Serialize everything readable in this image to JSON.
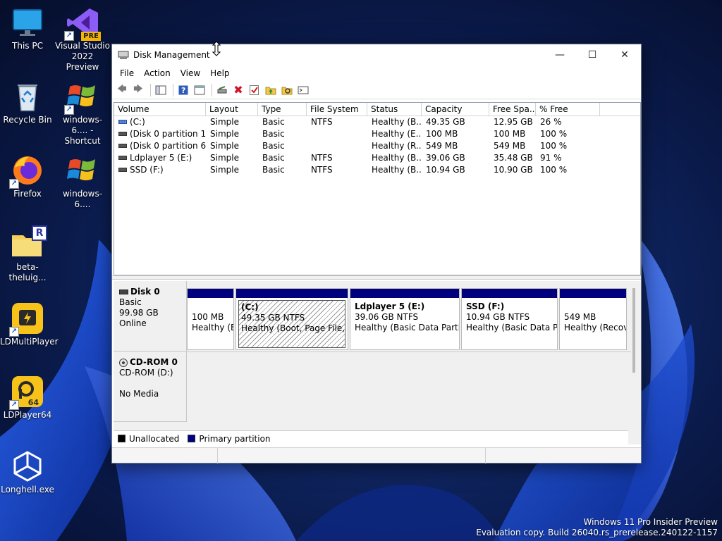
{
  "desktop": {
    "icons": [
      {
        "label": "This PC",
        "icon": "monitor-icon"
      },
      {
        "label": "Visual Studio 2022 Preview",
        "icon": "visual-studio-icon",
        "badge": "PRE"
      },
      {
        "label": "Recycle Bin",
        "icon": "recycle-bin-icon"
      },
      {
        "label": "windows-6.... - Shortcut",
        "icon": "windows-logo-icon"
      },
      {
        "label": "Firefox",
        "icon": "firefox-icon"
      },
      {
        "label": "windows-6....",
        "icon": "windows-logo-icon"
      },
      {
        "label": "beta-theluig...",
        "icon": "rar-archive-icon",
        "badge": "R"
      },
      {
        "label": "LDMultiPlayer",
        "icon": "ldmultiplayer-icon"
      },
      {
        "label": "LDPlayer64",
        "icon": "ldplayer64-icon",
        "badge": "64"
      },
      {
        "label": "Longhell.exe",
        "icon": "unity-icon"
      }
    ],
    "watermark": {
      "line1": "Windows 11 Pro Insider Preview",
      "line2": "Evaluation copy. Build 26040.rs_prerelease.240122-1157"
    }
  },
  "window": {
    "title": "Disk Management",
    "controls": {
      "minimize": "—",
      "maximize": "☐",
      "close": "✕"
    },
    "menu": [
      "File",
      "Action",
      "View",
      "Help"
    ],
    "toolbar": [
      "back-arrow-icon",
      "forward-arrow-icon",
      "console-tree-icon",
      "help-icon",
      "properties-icon",
      "connect-disk-icon",
      "delete-icon",
      "checkmark-icon",
      "folder-up-icon",
      "search-folder-icon",
      "rescan-icon"
    ],
    "volume_list": {
      "columns": [
        "Volume",
        "Layout",
        "Type",
        "File System",
        "Status",
        "Capacity",
        "Free Spa...",
        "% Free"
      ],
      "rows": [
        {
          "volume": "(C:)",
          "layout": "Simple",
          "type": "Basic",
          "fs": "NTFS",
          "status": "Healthy (B...",
          "capacity": "49.35 GB",
          "free": "12.95 GB",
          "pct": "26 %",
          "glyph": "c"
        },
        {
          "volume": "(Disk 0 partition 1)",
          "layout": "Simple",
          "type": "Basic",
          "fs": "",
          "status": "Healthy (E...",
          "capacity": "100 MB",
          "free": "100 MB",
          "pct": "100 %",
          "glyph": "d"
        },
        {
          "volume": "(Disk 0 partition 6)",
          "layout": "Simple",
          "type": "Basic",
          "fs": "",
          "status": "Healthy (R...",
          "capacity": "549 MB",
          "free": "549 MB",
          "pct": "100 %",
          "glyph": "d"
        },
        {
          "volume": "Ldplayer 5 (E:)",
          "layout": "Simple",
          "type": "Basic",
          "fs": "NTFS",
          "status": "Healthy (B...",
          "capacity": "39.06 GB",
          "free": "35.48 GB",
          "pct": "91 %",
          "glyph": "d"
        },
        {
          "volume": "SSD (F:)",
          "layout": "Simple",
          "type": "Basic",
          "fs": "NTFS",
          "status": "Healthy (B...",
          "capacity": "10.94 GB",
          "free": "10.90 GB",
          "pct": "100 %",
          "glyph": "d"
        }
      ]
    },
    "disks": [
      {
        "name": "Disk 0",
        "type": "Basic",
        "size": "99.98 GB",
        "state": "Online",
        "partitions": [
          {
            "name": "",
            "size": "100 MB",
            "status": "Healthy (E"
          },
          {
            "name": "(C:)",
            "size": "49.35 GB NTFS",
            "status": "Healthy (Boot, Page File, Cr"
          },
          {
            "name": "Ldplayer 5  (E:)",
            "size": "39.06 GB NTFS",
            "status": "Healthy (Basic Data Partitio"
          },
          {
            "name": "SSD  (F:)",
            "size": "10.94 GB NTFS",
            "status": "Healthy (Basic Data Par"
          },
          {
            "name": "",
            "size": "549 MB",
            "status": "Healthy (Recov"
          }
        ]
      },
      {
        "name": "CD-ROM 0",
        "type": "CD-ROM (D:)",
        "state": "No Media"
      }
    ],
    "legend": [
      {
        "label": "Unallocated",
        "color": "#000000"
      },
      {
        "label": "Primary partition",
        "color": "#00007f"
      }
    ]
  },
  "colors": {
    "partition_bar": "#00007f",
    "accent": "#0050d0"
  }
}
